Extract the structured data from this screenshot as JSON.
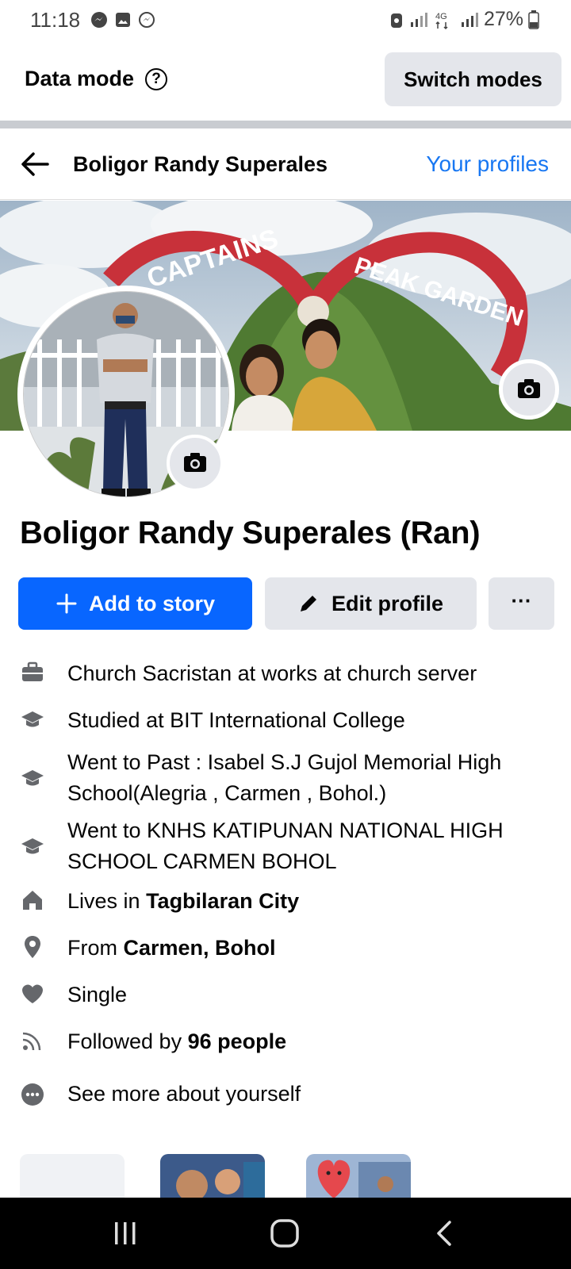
{
  "status": {
    "time": "11:18",
    "battery": "27%"
  },
  "data_mode": {
    "label": "Data mode",
    "help": "?",
    "switch_label": "Switch modes"
  },
  "nav": {
    "title": "Boligor Randy Superales",
    "your_profiles": "Your profiles"
  },
  "cover": {
    "sign_left": "CAPTAINS",
    "sign_right": "PEAK GARDEN"
  },
  "profile": {
    "name": "Boligor Randy Superales (Ran)"
  },
  "actions": {
    "add_story": "Add to story",
    "edit_profile": "Edit profile",
    "more": "···"
  },
  "details": {
    "work": "Church Sacristan at works at church server",
    "studied": "Studied at BIT International College",
    "went_past": "Went to Past : Isabel S.J Gujol Memorial High School(Alegria , Carmen , Bohol.)",
    "went_knhs": "Went to KNHS KATIPUNAN NATIONAL HIGH SCHOOL CARMEN BOHOL",
    "lives_prefix": "Lives in ",
    "lives_place": "Tagbilaran City",
    "from_prefix": "From ",
    "from_place": "Carmen, Bohol",
    "relationship": "Single",
    "followed_prefix": "Followed by ",
    "followed_count": "96 people",
    "see_more": "See more about yourself"
  },
  "icons": {
    "work": "briefcase-icon",
    "education": "graduation-cap-icon",
    "home": "home-icon",
    "location": "location-pin-icon",
    "relationship": "heart-icon",
    "followers": "rss-icon",
    "more": "more-dots-icon"
  },
  "colors": {
    "accent": "#0866ff",
    "link": "#1877f2",
    "button_gray": "#e4e6eb"
  }
}
